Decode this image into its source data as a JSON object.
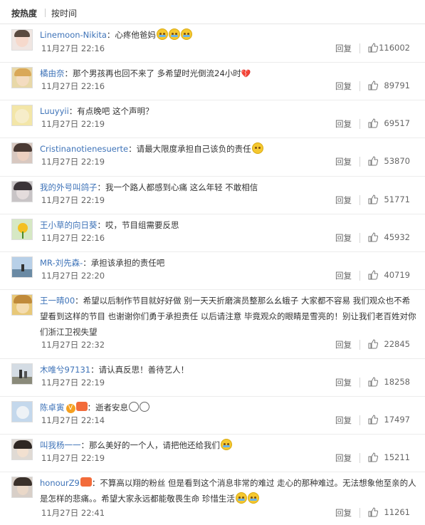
{
  "sort": {
    "hot": "按热度",
    "time": "按时间"
  },
  "comments": [
    {
      "user": "Linemoon-Nikita",
      "text": "：心疼他爸妈",
      "date": "11月27日 22:16",
      "reply": "回复",
      "likes": "116002"
    },
    {
      "user": "橘由奈",
      "text": "：那个男孩再也回不来了 多希望时光倒流24小时",
      "date": "11月27日 22:16",
      "reply": "回复",
      "likes": "89791"
    },
    {
      "user": "Luuyyii",
      "text": "：有点晚吧 这个声明？",
      "date": "11月27日 22:19",
      "reply": "回复",
      "likes": "69517"
    },
    {
      "user": "Cristinanotienesuerte",
      "text": "：请最大限度承担自己该负的责任",
      "date": "11月27日 22:19",
      "reply": "回复",
      "likes": "53870"
    },
    {
      "user": "我的外号叫鸽子",
      "text": "：我一个路人都感到心痛 这么年轻 不敢相信",
      "date": "11月27日 22:19",
      "reply": "回复",
      "likes": "51771"
    },
    {
      "user": "王小草的向日葵",
      "text": "：哎，节目组需要反思",
      "date": "11月27日 22:16",
      "reply": "回复",
      "likes": "45932"
    },
    {
      "user": "MR-刘先森-",
      "text": "：承担该承担的责任吧",
      "date": "11月27日 22:20",
      "reply": "回复",
      "likes": "40719"
    },
    {
      "user": "王一晴00",
      "text": "：希望以后制作节目就好好做  别一天天折磨演员整那么幺蛾子  大家都不容易  我们观众也不希望看到这样的节目 也谢谢你们勇于承担责任  以后请注意 毕竟观众的眼睛是雪亮的！别让我们老百姓对你们浙江卫视失望",
      "date": "11月27日 22:32",
      "reply": "回复",
      "likes": "22845"
    },
    {
      "user": "木唯兮97131",
      "text": "：请认真反思！善待艺人！",
      "date": "11月27日 22:19",
      "reply": "回复",
      "likes": "18258"
    },
    {
      "user": "陈卓寅",
      "text": "：逝者安息",
      "date": "11月27日 22:14",
      "reply": "回复",
      "likes": "17497"
    },
    {
      "user": "叫我杨一一",
      "text": "：那么美好的一个人，请把他还给我们",
      "date": "11月27日 22:19",
      "reply": "回复",
      "likes": "15211"
    },
    {
      "user": "honourZ9",
      "text": "：不算高以翔的粉丝 但是看到这个消息非常的难过 走心的那种难过。无法想象他至亲的人是怎样的悲痛。。希望大家永远都能敬畏生命 珍惜生活",
      "date": "11月27日 22:41",
      "reply": "回复",
      "likes": "11261"
    }
  ],
  "colors": {
    "username": "#3e73b8",
    "text": "#333333",
    "meta": "#666666"
  }
}
